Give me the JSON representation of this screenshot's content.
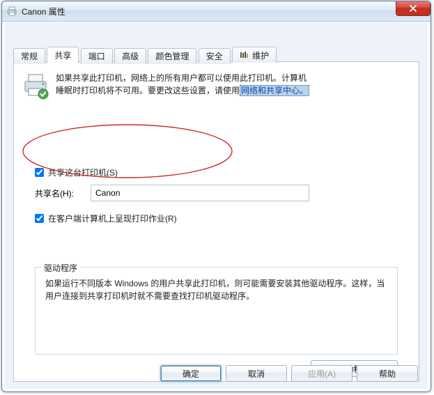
{
  "window": {
    "title": "Canon 属性"
  },
  "tabs": [
    {
      "label": "常规"
    },
    {
      "label": "共享"
    },
    {
      "label": "端口"
    },
    {
      "label": "高级"
    },
    {
      "label": "颜色管理"
    },
    {
      "label": "安全"
    },
    {
      "label": "维护",
      "icon": "maintenance-icon"
    }
  ],
  "share": {
    "info_a": "如果共享此打印机，网络上的所有用户都可以使用此打印机。计算机",
    "info_b": "睡眠时打印机将不可用。要更改这些设置，请使用",
    "info_link": "网络和共享中心。",
    "checkbox_label": "共享这台打印机(S)",
    "name_label": "共享名(H):",
    "name_value": "Canon",
    "render_jobs_label": "在客户端计算机上呈现打印作业(R)"
  },
  "drivers": {
    "legend": "驱动程序",
    "desc": "如果运行不同版本 Windows 的用户共享此打印机，则可能需要安装其他驱动程序。这样，当用户连接到共享打印机时就不需要查找打印机驱动程序。",
    "button": "其他驱动程序(D)..."
  },
  "buttons": {
    "ok": "确定",
    "cancel": "取消",
    "apply": "应用(A)",
    "help": "帮助"
  }
}
